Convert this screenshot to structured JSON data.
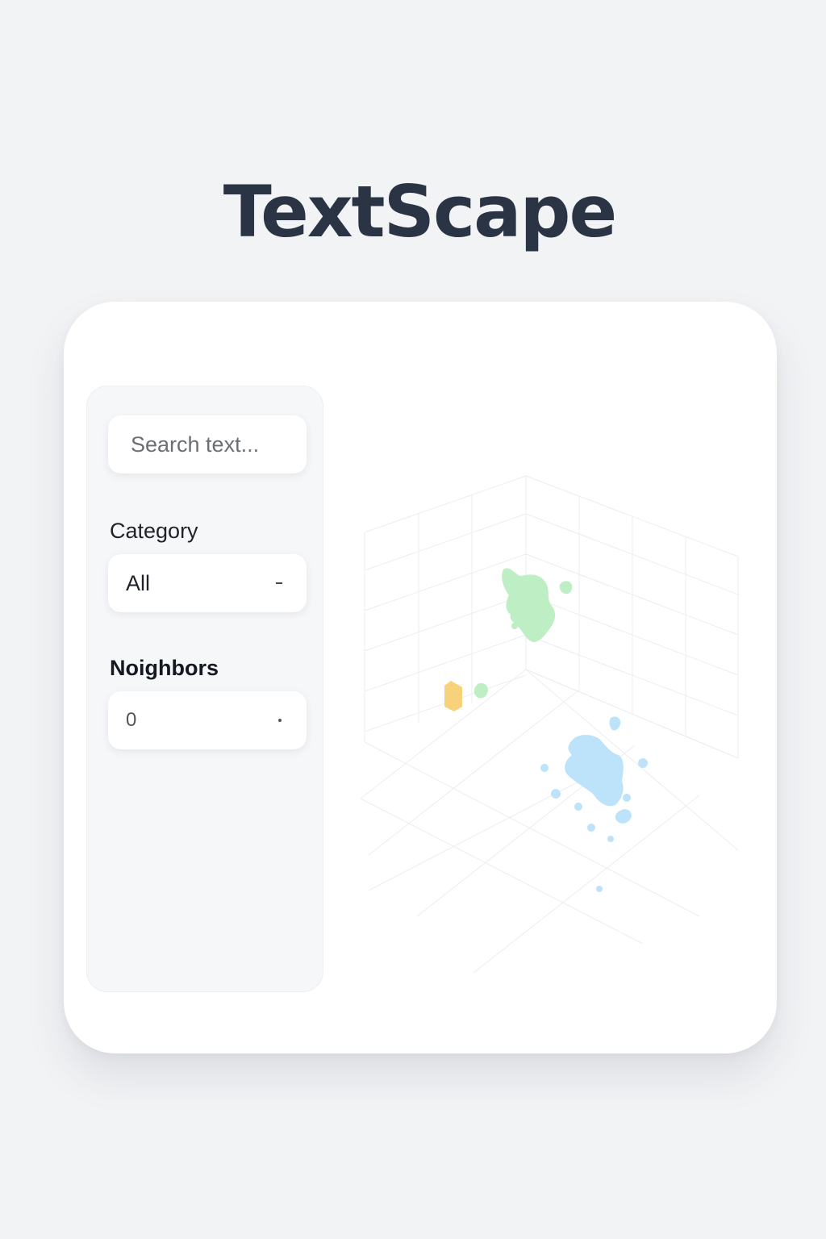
{
  "app": {
    "title": "TextScape"
  },
  "sidebar": {
    "search": {
      "placeholder": "Search text..."
    },
    "category": {
      "label": "Category",
      "value": "All"
    },
    "neighbors": {
      "label": "Noighbors",
      "value": "0"
    }
  },
  "visualization": {
    "clusters": [
      {
        "name": "green-cluster",
        "color": "#bdeec4"
      },
      {
        "name": "yellow-cluster",
        "color": "#f8d27a"
      },
      {
        "name": "blue-cluster",
        "color": "#bde3fa"
      }
    ],
    "grid_color": "#ebedf0"
  }
}
